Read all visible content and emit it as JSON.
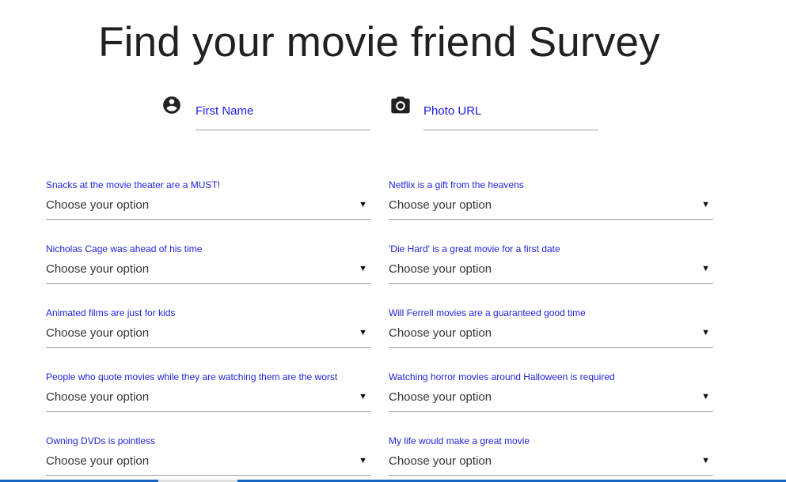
{
  "title": "Find your movie friend Survey",
  "fields": {
    "first_name": {
      "placeholder": "First Name",
      "icon": "account-circle-icon"
    },
    "photo_url": {
      "placeholder": "Photo URL",
      "icon": "camera-icon"
    }
  },
  "questions": [
    {
      "label": "Snacks at the movie theater are a MUST!",
      "value": "Choose your option"
    },
    {
      "label": "Netflix is a gift from the heavens",
      "value": "Choose your option"
    },
    {
      "label": "Nicholas Cage was ahead of his time",
      "value": "Choose your option"
    },
    {
      "label": "'Die Hard' is a great movie for a first date",
      "value": "Choose your option"
    },
    {
      "label": "Animated films are just for kids",
      "value": "Choose your option"
    },
    {
      "label": "Will Ferrell movies are a guaranteed good time",
      "value": "Choose your option"
    },
    {
      "label": "People who quote movies while they are watching them are the worst",
      "value": "Choose your option"
    },
    {
      "label": "Watching horror movies around Halloween is required",
      "value": "Choose your option"
    },
    {
      "label": "Owning DVDs is pointless",
      "value": "Choose your option"
    },
    {
      "label": "My life would make a great movie",
      "value": "Choose your option"
    }
  ],
  "caret": "▼",
  "colors": {
    "label": "#1f1fd6",
    "placeholder": "#1a1ae6",
    "underline": "#9e9e9e",
    "title": "#212121"
  }
}
